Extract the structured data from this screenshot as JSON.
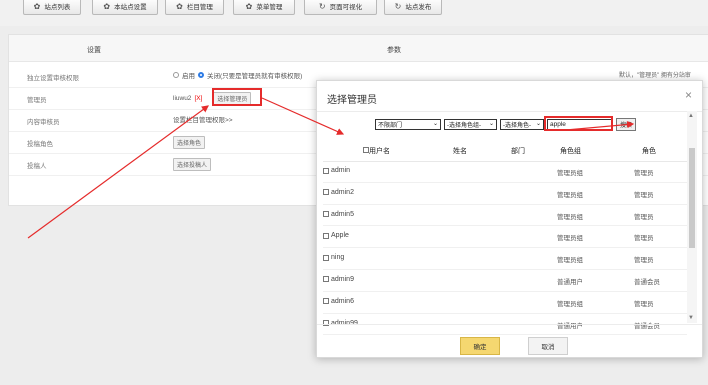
{
  "toolbar": {
    "buttons": [
      {
        "label": "站点列表",
        "icon": "gear-icon"
      },
      {
        "label": "本站点设置",
        "icon": "gear-icon"
      },
      {
        "label": "栏目管理",
        "icon": "gear-icon"
      },
      {
        "label": "菜单管理",
        "icon": "gear-icon"
      },
      {
        "label": "页面可视化",
        "icon": "refresh-icon"
      },
      {
        "label": "站点发布",
        "icon": "refresh-icon"
      }
    ]
  },
  "panel": {
    "head_settings": "设置",
    "head_params": "参数",
    "rows": [
      {
        "label": "独立设置审核权限",
        "enable": "启用",
        "close": "关闭(只要是管理员就有审核权限)",
        "note": "默认，\"管理员\" 拥有分站审"
      },
      {
        "label": "管理员",
        "value": "liuwu2",
        "remove": "[X]",
        "button": "选择管理员"
      },
      {
        "label": "内容审核员",
        "value": "设置栏目管理权限>>"
      },
      {
        "label": "投稿角色",
        "button": "选择角色"
      },
      {
        "label": "投稿人",
        "button": "选择投稿人"
      }
    ]
  },
  "dialog": {
    "title": "选择管理员",
    "close": "×",
    "filters": {
      "department": "不限部门",
      "role_group": "-选择角色组-",
      "role": "-选择角色-",
      "keyword": "apple",
      "search_label": "搜索"
    },
    "columns": {
      "username": "用户名",
      "realname": "姓名",
      "department": "部门",
      "role_group": "角色组",
      "role": "角色"
    },
    "rows": [
      {
        "username": "admin",
        "group": "管理员组",
        "role": "管理员"
      },
      {
        "username": "admin2",
        "group": "管理员组",
        "role": "管理员"
      },
      {
        "username": "admin5",
        "group": "管理员组",
        "role": "管理员"
      },
      {
        "username": "Apple",
        "group": "管理员组",
        "role": "管理员"
      },
      {
        "username": "ning",
        "group": "管理员组",
        "role": "管理员"
      },
      {
        "username": "admin9",
        "group": "普通用户",
        "role": "普通会员"
      },
      {
        "username": "admin6",
        "group": "管理员组",
        "role": "管理员"
      },
      {
        "username": "admin99",
        "group": "普通用户",
        "role": "普通会员"
      }
    ],
    "ok_label": "确定",
    "cancel_label": "取消"
  },
  "colors": {
    "accent": "#f5d770",
    "annotation": "#e52b2b",
    "radio": "#2d7be5"
  }
}
